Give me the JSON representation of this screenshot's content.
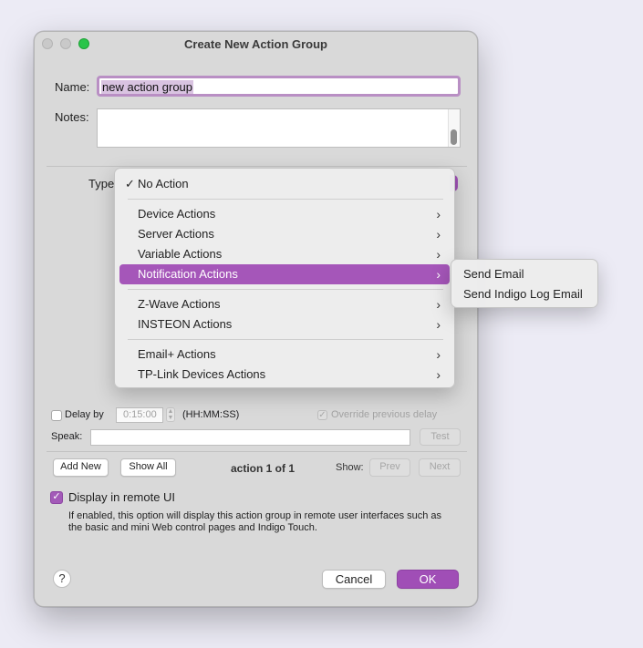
{
  "window": {
    "title": "Create New Action Group"
  },
  "form": {
    "name_label": "Name:",
    "name_value": "new action group",
    "notes_label": "Notes:",
    "type_label": "Type"
  },
  "menu": {
    "items": [
      {
        "label": "No Action",
        "checked": true
      },
      {
        "label": "Device Actions"
      },
      {
        "label": "Server Actions"
      },
      {
        "label": "Variable Actions"
      },
      {
        "label": "Notification Actions",
        "selected": true
      },
      {
        "label": "Z-Wave Actions"
      },
      {
        "label": "INSTEON Actions"
      },
      {
        "label": "Email+ Actions"
      },
      {
        "label": "TP-Link Devices Actions"
      }
    ],
    "check_glyph": "✓",
    "chevron_glyph": "›",
    "selected_color": "#a556b9"
  },
  "submenu": {
    "items": [
      {
        "label": "Send Email"
      },
      {
        "label": "Send Indigo Log Email"
      }
    ]
  },
  "delay": {
    "label": "Delay by",
    "value": "0:15:00",
    "format": "(HH:MM:SS)",
    "override_label": "Override previous delay"
  },
  "speak": {
    "label": "Speak:",
    "test_label": "Test"
  },
  "actions_bar": {
    "add_new": "Add New",
    "show_all": "Show All",
    "counter": "action 1 of 1",
    "show_label": "Show:",
    "prev": "Prev",
    "next": "Next"
  },
  "remote": {
    "label": "Display in remote UI",
    "description": "If enabled, this option will display this action group in remote user interfaces such as the basic and mini Web control pages and Indigo Touch."
  },
  "footer": {
    "help": "?",
    "cancel": "Cancel",
    "ok": "OK"
  },
  "colors": {
    "accent": "#a04eb6",
    "zoom_button": "#2ac54a"
  }
}
